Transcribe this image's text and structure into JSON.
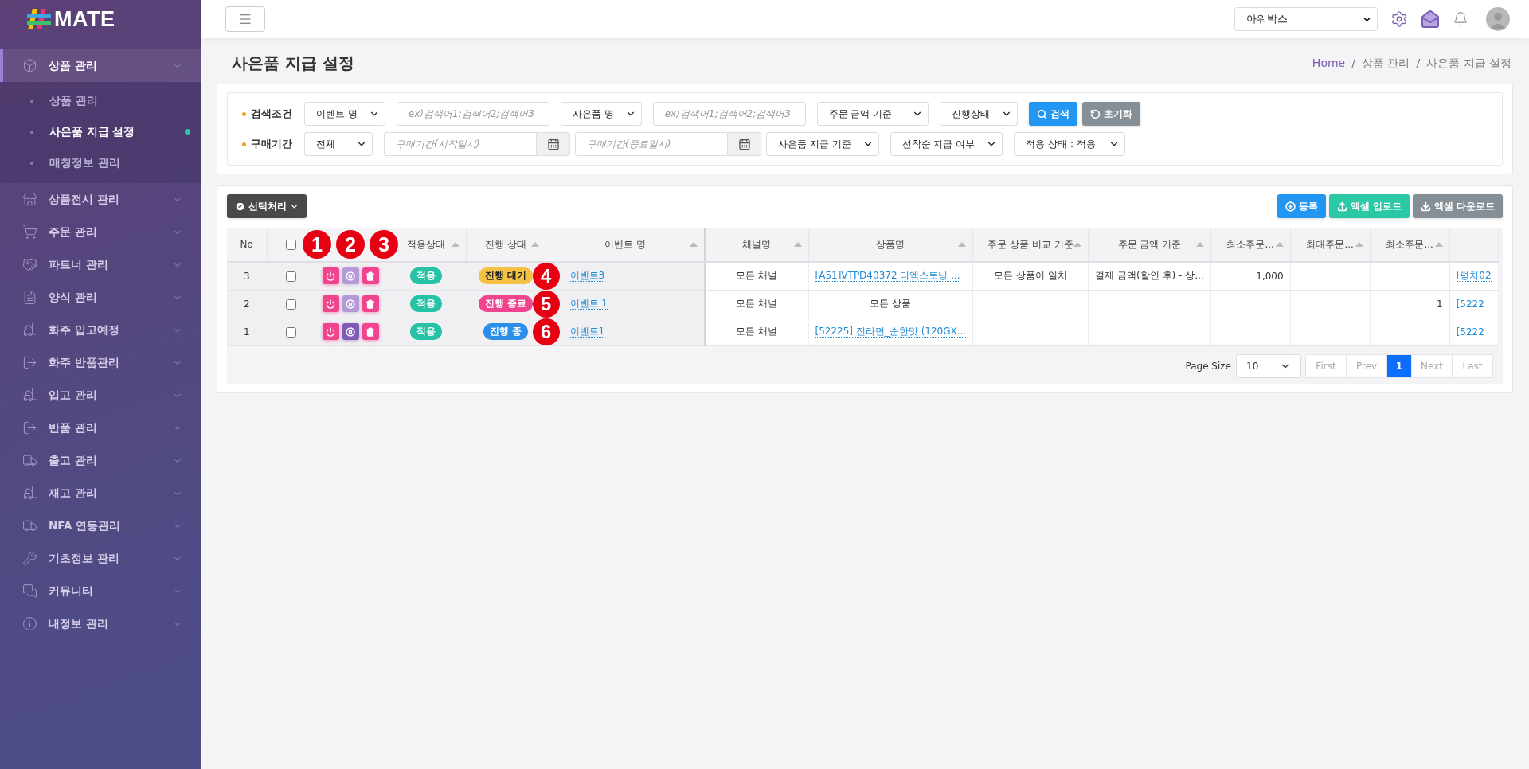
{
  "sidebar": {
    "logo": "MATE",
    "items": [
      {
        "label": "상품 관리",
        "selected": true,
        "children": [
          {
            "label": "상품 관리",
            "selected": false
          },
          {
            "label": "사은품 지급 설정",
            "selected": true
          },
          {
            "label": "매칭정보 관리",
            "selected": false
          }
        ]
      },
      {
        "label": "상품전시 관리",
        "selected": false
      },
      {
        "label": "주문 관리",
        "selected": false
      },
      {
        "label": "파트너 관리",
        "selected": false
      },
      {
        "label": "양식 관리",
        "selected": false
      },
      {
        "label": "화주 입고예정",
        "selected": false
      },
      {
        "label": "화주 반품관리",
        "selected": false
      },
      {
        "label": "입고 관리",
        "selected": false
      },
      {
        "label": "반품 관리",
        "selected": false
      },
      {
        "label": "출고 관리",
        "selected": false
      },
      {
        "label": "재고 관리",
        "selected": false
      },
      {
        "label": "NFA 연동관리",
        "selected": false
      },
      {
        "label": "기초정보 관리",
        "selected": false
      },
      {
        "label": "커뮤니티",
        "selected": false
      },
      {
        "label": "내정보 관리",
        "selected": false
      }
    ]
  },
  "topbar": {
    "company": "아워박스"
  },
  "page": {
    "title": "사은품 지급 설정",
    "breadcrumb": [
      {
        "label": "Home",
        "link": true
      },
      {
        "label": "상품 관리",
        "link": false
      },
      {
        "label": "사은품 지급 설정",
        "link": false
      }
    ],
    "separator": "/"
  },
  "filters": [
    {
      "label": "검색조건",
      "controls": [
        {
          "kind": "select",
          "value": "이벤트 명"
        },
        {
          "kind": "input",
          "placeholder": "ex)검색어1;검색어2;검색어3"
        },
        {
          "kind": "select",
          "value": "사은품 명"
        },
        {
          "kind": "input",
          "placeholder": "ex)검색어1;검색어2;검색어3"
        },
        {
          "kind": "select",
          "value": "주문 금액 기준"
        },
        {
          "kind": "select",
          "value": "진행상태"
        },
        {
          "kind": "search",
          "label": "검색"
        },
        {
          "kind": "reset",
          "label": "초기화"
        }
      ]
    },
    {
      "label": "구매기간",
      "controls": [
        {
          "kind": "select",
          "value": "전체"
        },
        {
          "kind": "date",
          "placeholder": "구매기간(시작일시)"
        },
        {
          "kind": "date",
          "placeholder": "구매기간(종료일시)"
        },
        {
          "kind": "select",
          "value": "사은품 지급 기준"
        },
        {
          "kind": "select",
          "value": "선착순 지급 여부"
        },
        {
          "kind": "select",
          "value": "적용 상태 : 적용"
        }
      ]
    }
  ],
  "toolbar": {
    "bulk": "선택처리",
    "buttons": [
      "등록",
      "엑셀 업로드",
      "엑셀 다운로드"
    ]
  },
  "table": {
    "columns": [
      {
        "kind": "text",
        "label": "No",
        "sortable": false
      },
      {
        "kind": "checkbox",
        "checked": false
      },
      {
        "kind": "actions",
        "annotations": [
          "1",
          "2",
          "3"
        ]
      },
      {
        "kind": "text",
        "label": "적용상태",
        "sortable": true
      },
      {
        "kind": "text",
        "label": "진행 상태",
        "sortable": true
      },
      {
        "kind": "text",
        "label": "이벤트 명",
        "sortable": true
      },
      {
        "kind": "text",
        "label": "채널명",
        "sortable": true
      },
      {
        "kind": "text",
        "label": "상품명",
        "sortable": true
      },
      {
        "kind": "text",
        "label": "주문 상품 비교 기준",
        "sortable": true
      },
      {
        "kind": "text",
        "label": "주문 금액 기준",
        "sortable": true
      },
      {
        "kind": "text",
        "label": "최소주문...",
        "sortable": true
      },
      {
        "kind": "text",
        "label": "최대주문...",
        "sortable": true
      },
      {
        "kind": "text",
        "label": "최소주문...",
        "sortable": true
      },
      {
        "kind": "blank"
      }
    ],
    "rows": [
      {
        "cells": [
          {
            "kind": "text",
            "text": "3"
          },
          {
            "kind": "checkbox",
            "checked": false
          },
          {
            "kind": "actions",
            "stop_active": false
          },
          {
            "kind": "badge",
            "text": "적용"
          },
          {
            "kind": "status",
            "text": "진행 대기",
            "color": "#f5c145",
            "annotation": "4"
          },
          {
            "kind": "link",
            "text": "이벤트3"
          },
          {
            "kind": "text",
            "text": "모든 채널"
          },
          {
            "kind": "link",
            "text": "[A51]VTPD40372 티엑스토닝 ..."
          },
          {
            "kind": "text",
            "text": "모든 상품이 일치"
          },
          {
            "kind": "text",
            "text": "결제 금액(할인 후) - 상..."
          },
          {
            "kind": "text",
            "text": "1,000"
          },
          "",
          "",
          {
            "kind": "link",
            "text": "[평치02"
          }
        ]
      },
      {
        "cells": [
          {
            "kind": "text",
            "text": "2"
          },
          {
            "kind": "checkbox",
            "checked": false
          },
          {
            "kind": "actions",
            "stop_active": false
          },
          {
            "kind": "badge",
            "text": "적용"
          },
          {
            "kind": "status",
            "text": "진행 종료",
            "color": "#f0448f",
            "annotation": "5"
          },
          {
            "kind": "link",
            "text": "이벤트 1"
          },
          {
            "kind": "text",
            "text": "모든 채널"
          },
          {
            "kind": "text",
            "text": "모든 상품"
          },
          "",
          "",
          "",
          "",
          {
            "kind": "text",
            "text": "1"
          },
          {
            "kind": "link",
            "text": "[5222"
          }
        ]
      },
      {
        "cells": [
          {
            "kind": "text",
            "text": "1"
          },
          {
            "kind": "checkbox",
            "checked": false
          },
          {
            "kind": "actions",
            "stop_active": true
          },
          {
            "kind": "badge",
            "text": "적용"
          },
          {
            "kind": "status",
            "text": "진행 중",
            "color": "#2b8ee8",
            "annotation": "6"
          },
          {
            "kind": "link",
            "text": "이벤트1"
          },
          {
            "kind": "text",
            "text": "모든 채널"
          },
          {
            "kind": "link",
            "text": "[52225] 진라면_순한맛 (120GX..."
          },
          "",
          "",
          "",
          "",
          "",
          {
            "kind": "link",
            "text": "[5222"
          }
        ]
      }
    ]
  },
  "pagination": {
    "label": "Page Size",
    "size": "10",
    "pages": [
      {
        "label": "First",
        "kind": "nav",
        "disabled": true,
        "selected": false
      },
      {
        "label": "Prev",
        "kind": "nav",
        "disabled": true,
        "selected": false
      },
      {
        "label": "1",
        "kind": "page",
        "disabled": false,
        "selected": true
      },
      {
        "label": "Next",
        "kind": "nav",
        "disabled": true,
        "selected": false
      },
      {
        "label": "Last",
        "kind": "nav",
        "disabled": true,
        "selected": false
      }
    ]
  }
}
